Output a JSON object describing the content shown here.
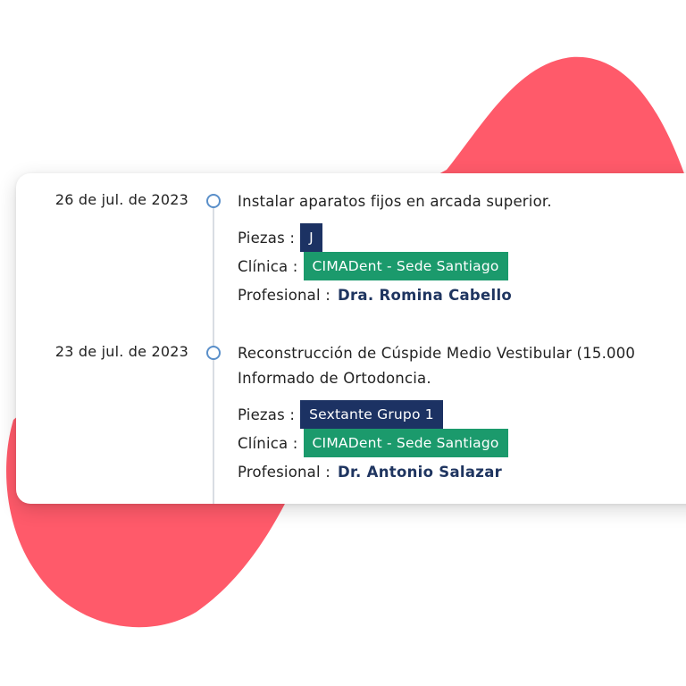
{
  "colors": {
    "blob": "#ff5a6a",
    "piezas_badge": "#1c3263",
    "clinic_badge": "#1b9a6c",
    "doctor_text": "#1f3560",
    "timeline_dot": "#5a8fc9"
  },
  "labels": {
    "piezas": "Piezas :",
    "clinica": "Clínica :",
    "profesional": "Profesional :"
  },
  "entries": [
    {
      "date": "26 de jul. de 2023",
      "description_lines": [
        "Instalar aparatos fijos en arcada superior."
      ],
      "piezas": "J",
      "clinica": "CIMADent - Sede Santiago",
      "profesional": "Dra. Romina Cabello"
    },
    {
      "date": "23 de jul. de 2023",
      "description_lines": [
        "Reconstrucción de Cúspide Medio Vestibular (15.000",
        "Informado de Ortodoncia."
      ],
      "piezas": "Sextante Grupo 1",
      "clinica": "CIMADent - Sede Santiago",
      "profesional": "Dr. Antonio Salazar"
    }
  ]
}
